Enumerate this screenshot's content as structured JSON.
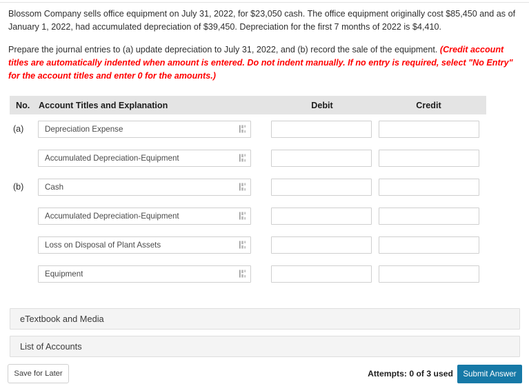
{
  "problem": {
    "paragraph1": "Blossom Company sells office equipment on July 31, 2022, for $23,050 cash. The office equipment originally cost $85,450 and as of January 1, 2022, had accumulated depreciation of $39,450. Depreciation for the first 7 months of 2022 is $4,410.",
    "paragraph2_lead": "Prepare the journal entries to (a) update depreciation to July 31, 2022, and (b) record the sale of the equipment. ",
    "paragraph2_note": "(Credit account titles are automatically indented when amount is entered. Do not indent manually. If no entry is required, select \"No Entry\" for the account titles and enter 0 for the amounts.)"
  },
  "table": {
    "headers": {
      "no": "No.",
      "account": "Account Titles and Explanation",
      "debit": "Debit",
      "credit": "Credit"
    },
    "rows": [
      {
        "no": "(a)",
        "account": "Depreciation Expense",
        "debit": "",
        "credit": ""
      },
      {
        "no": "",
        "account": "Accumulated Depreciation-Equipment",
        "debit": "",
        "credit": ""
      },
      {
        "no": "(b)",
        "account": "Cash",
        "debit": "",
        "credit": ""
      },
      {
        "no": "",
        "account": "Accumulated Depreciation-Equipment",
        "debit": "",
        "credit": ""
      },
      {
        "no": "",
        "account": "Loss on Disposal of Plant Assets",
        "debit": "",
        "credit": ""
      },
      {
        "no": "",
        "account": "Equipment",
        "debit": "",
        "credit": ""
      }
    ]
  },
  "panels": {
    "etextbook": "eTextbook and Media",
    "list_of_accounts": "List of Accounts"
  },
  "footer": {
    "save_label": "Save for Later",
    "attempts": "Attempts: 0 of 3 used",
    "submit_label": "Submit Answer"
  },
  "colors": {
    "submit_blue": "#1679a7",
    "header_gray": "#e4e4e4",
    "panel_gray": "#f4f4f4",
    "note_red": "#ff0000"
  }
}
